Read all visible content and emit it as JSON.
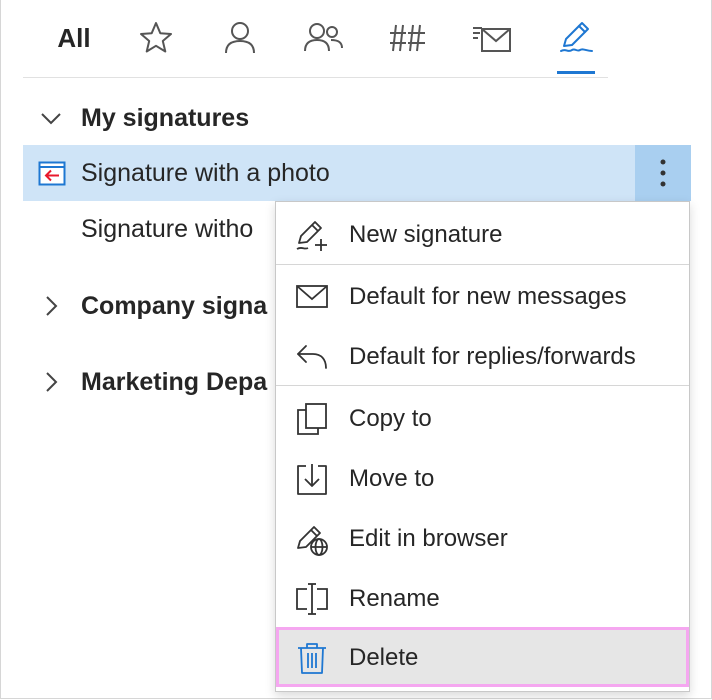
{
  "tabs": [
    {
      "label": "All",
      "icon": "all-text"
    },
    {
      "icon": "star-icon"
    },
    {
      "icon": "person-icon"
    },
    {
      "icon": "people-icon"
    },
    {
      "icon": "hashtag-icon"
    },
    {
      "icon": "mail-stack-icon"
    },
    {
      "icon": "signature-pen-icon",
      "active": true
    }
  ],
  "tree": {
    "my_signatures": "My signatures",
    "signature_with_photo": "Signature with a photo",
    "signature_without": "Signature witho",
    "company_signatures": "Company signa",
    "marketing": "Marketing Depa"
  },
  "menu": {
    "items": [
      {
        "label": "New signature",
        "icon": "new-signature-icon"
      },
      {
        "label": "Default for new messages",
        "icon": "envelope-icon"
      },
      {
        "label": "Default for replies/forwards",
        "icon": "reply-icon"
      },
      {
        "label": "Copy to",
        "icon": "copy-to-icon"
      },
      {
        "label": "Move to",
        "icon": "move-to-icon"
      },
      {
        "label": "Edit in browser",
        "icon": "edit-in-browser-icon"
      },
      {
        "label": "Rename",
        "icon": "rename-icon"
      },
      {
        "label": "Delete",
        "icon": "trash-icon"
      }
    ]
  },
  "colors": {
    "accent": "#1e77d2",
    "selected_row": "#cfe4f7",
    "more_button": "#a9cff0",
    "delete_highlight_border": "#f5a7f0",
    "delete_icon": "#1e77d2",
    "signature_arrow": "#e8192c"
  }
}
